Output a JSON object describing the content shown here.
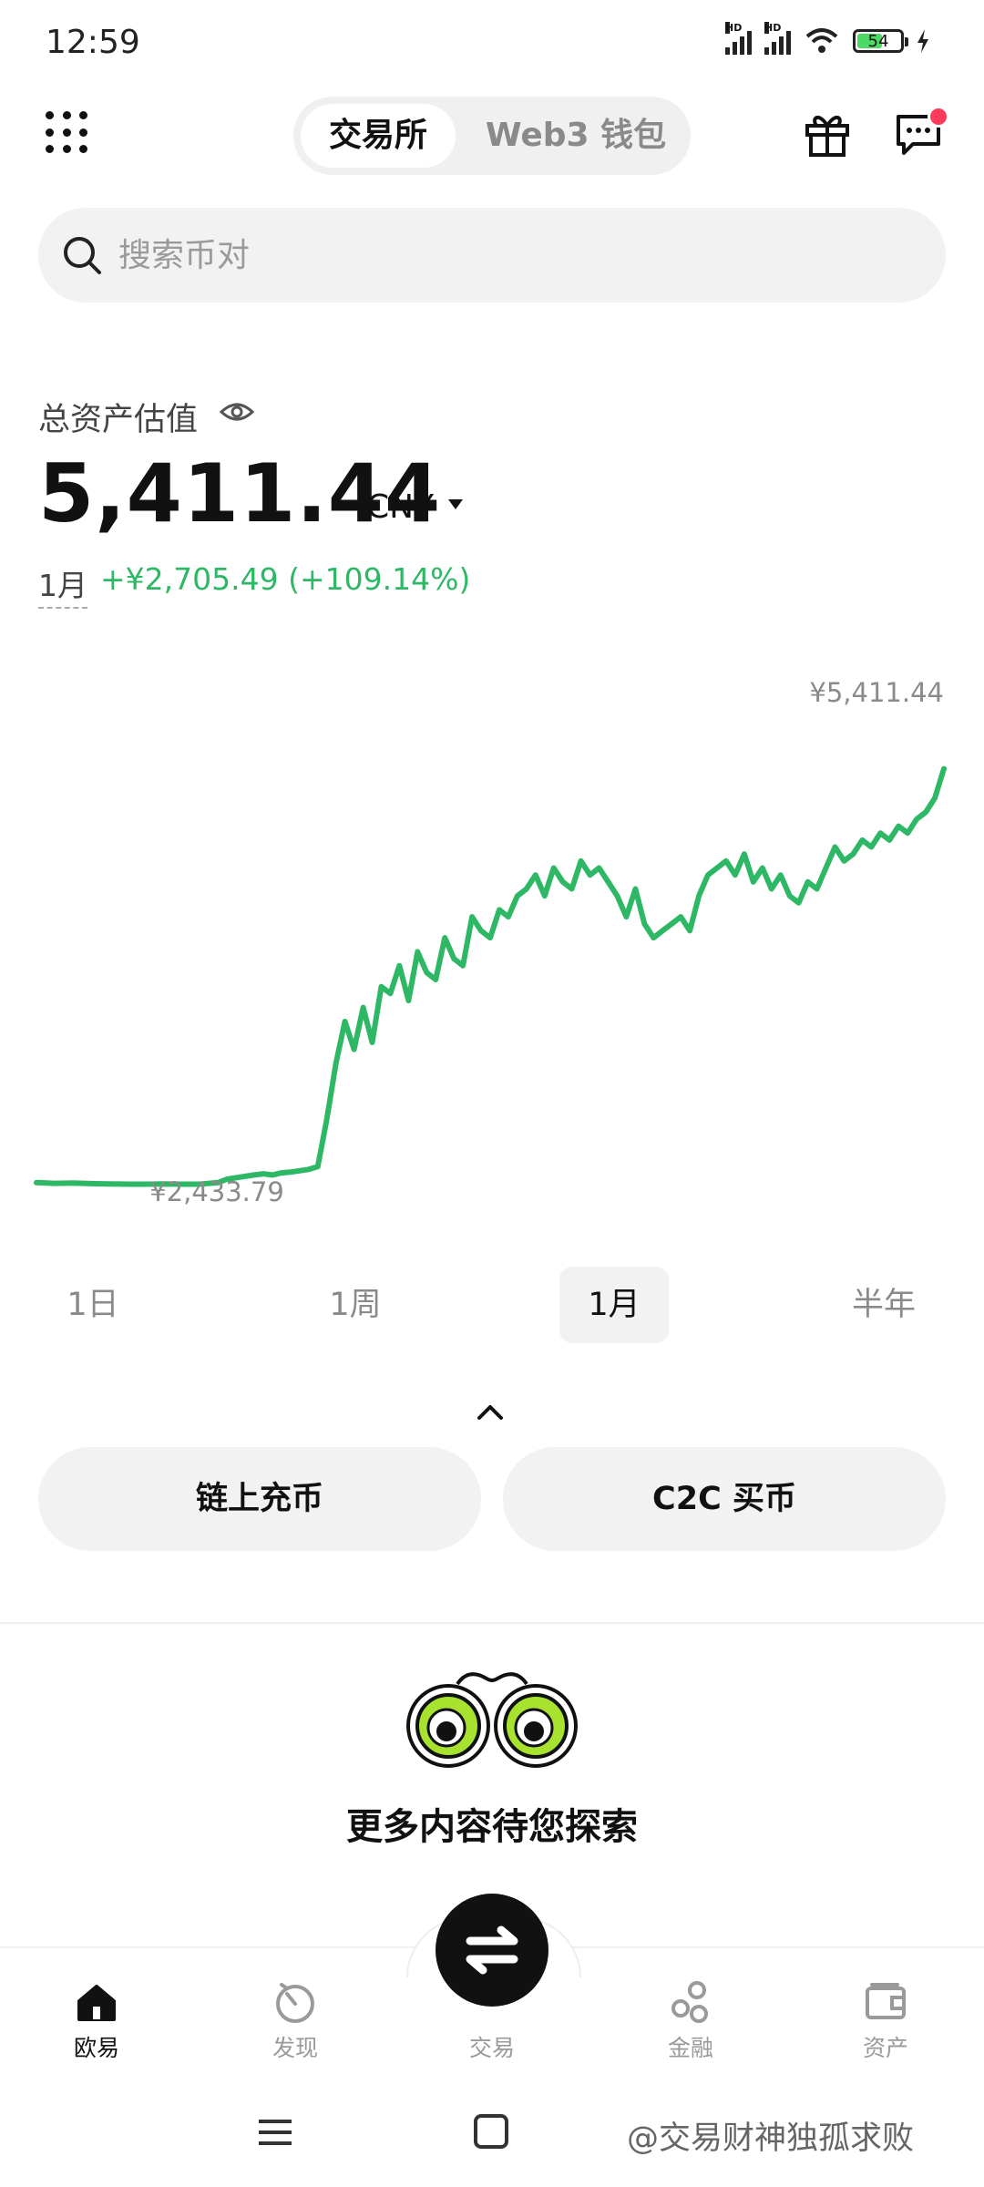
{
  "status_bar": {
    "time": "12:59",
    "battery": "54"
  },
  "header": {
    "tabs": [
      {
        "label": "交易所",
        "active": true
      },
      {
        "label": "Web3 钱包",
        "active": false
      }
    ]
  },
  "search": {
    "placeholder": "搜索币对"
  },
  "assets": {
    "label": "总资产估值",
    "value": "5,411.44",
    "currency": "CNY",
    "period": "1月",
    "change": "+¥2,705.49 (+109.14%)"
  },
  "chart_data": {
    "type": "line",
    "title": "",
    "xlabel": "",
    "ylabel": "",
    "color": "#2eb865",
    "max_label": "¥5,411.44",
    "min_label": "¥2,433.79",
    "ylim": [
      2300,
      5500
    ],
    "x": [
      0,
      2,
      4,
      6,
      8,
      10,
      12,
      14,
      16,
      18,
      20,
      21,
      22,
      23,
      24,
      25,
      26,
      27,
      28,
      29,
      30,
      31,
      32,
      33,
      34,
      35,
      36,
      37,
      38,
      39,
      40,
      41,
      42,
      43,
      44,
      45,
      46,
      47,
      48,
      49,
      50,
      51,
      52,
      53,
      54,
      55,
      56,
      57,
      58,
      59,
      60,
      61,
      62,
      63,
      64,
      65,
      66,
      67,
      68,
      69,
      70,
      71,
      72,
      73,
      74,
      75,
      76,
      77,
      78,
      79,
      80,
      81,
      82,
      83,
      84,
      85,
      86,
      87,
      88,
      89,
      90,
      91,
      92,
      93,
      94,
      95,
      96,
      97,
      98,
      99,
      100
    ],
    "values": [
      2445,
      2440,
      2442,
      2438,
      2436,
      2434,
      2434,
      2436,
      2434,
      2433.79,
      2445,
      2470,
      2480,
      2490,
      2500,
      2508,
      2500,
      2515,
      2520,
      2530,
      2540,
      2560,
      2900,
      3300,
      3600,
      3400,
      3700,
      3450,
      3850,
      3800,
      4000,
      3750,
      4100,
      3950,
      3900,
      4200,
      4050,
      4000,
      4350,
      4250,
      4200,
      4400,
      4350,
      4500,
      4550,
      4650,
      4500,
      4700,
      4600,
      4550,
      4750,
      4650,
      4700,
      4600,
      4500,
      4350,
      4550,
      4300,
      4200,
      4250,
      4300,
      4350,
      4250,
      4500,
      4650,
      4700,
      4750,
      4650,
      4800,
      4600,
      4700,
      4550,
      4650,
      4500,
      4450,
      4600,
      4550,
      4700,
      4850,
      4750,
      4800,
      4900,
      4850,
      4950,
      4900,
      5000,
      4950,
      5050,
      5100,
      5200,
      5411.44
    ]
  },
  "ranges": [
    {
      "label": "1日",
      "active": false
    },
    {
      "label": "1周",
      "active": false
    },
    {
      "label": "1月",
      "active": true
    },
    {
      "label": "半年",
      "active": false
    }
  ],
  "actions": [
    {
      "label": "链上充币"
    },
    {
      "label": "C2C 买币"
    }
  ],
  "explore": {
    "title": "更多内容待您探索"
  },
  "nav": [
    {
      "label": "欧易",
      "icon": "home-icon",
      "active": true
    },
    {
      "label": "发现",
      "icon": "discover-icon",
      "active": false
    },
    {
      "label": "交易",
      "icon": "swap-icon",
      "active": false
    },
    {
      "label": "金融",
      "icon": "finance-icon",
      "active": false
    },
    {
      "label": "资产",
      "icon": "wallet-icon",
      "active": false
    }
  ],
  "watermark": "@交易财神独孤求败"
}
